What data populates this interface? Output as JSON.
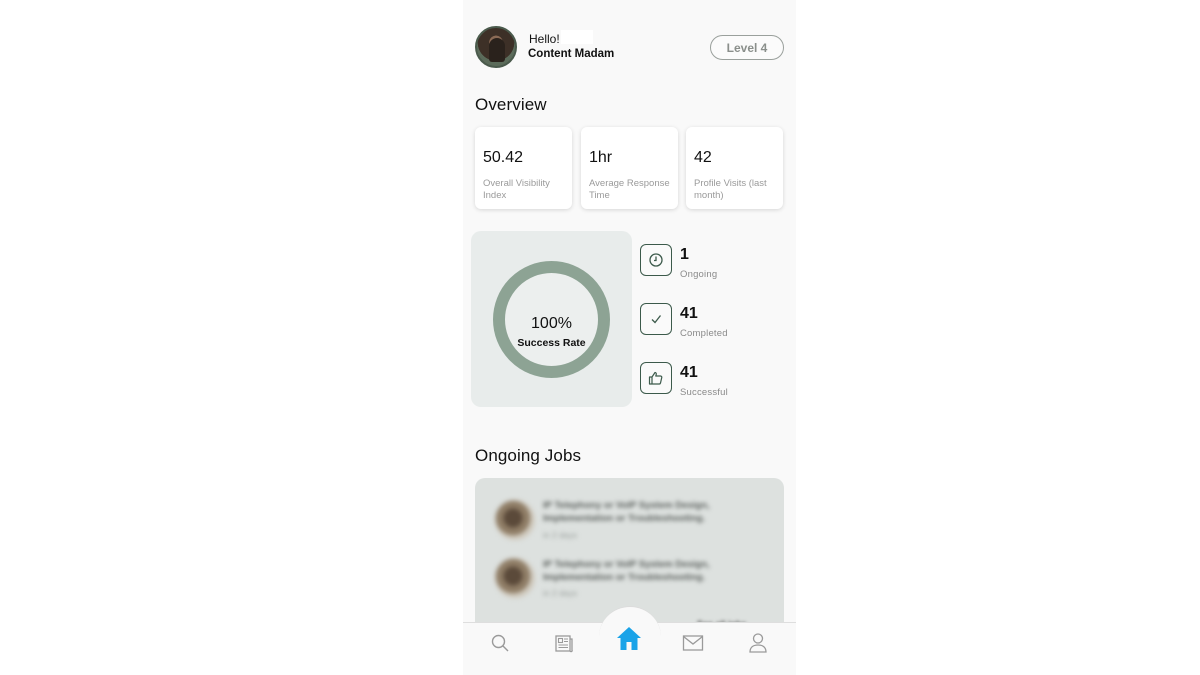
{
  "header": {
    "greeting": "Hello!",
    "user_name": "Content Madam",
    "level_label": "Level 4"
  },
  "overview": {
    "title": "Overview",
    "cards": [
      {
        "value": "50.42",
        "label": "Overall Visibility Index"
      },
      {
        "value": "1hr",
        "label": "Average Response Time"
      },
      {
        "value": "42",
        "label": "Profile Visits (last month)"
      }
    ]
  },
  "success": {
    "percent": "100%",
    "label": "Success Rate",
    "fraction": 1.0
  },
  "stats": [
    {
      "icon": "clock-icon",
      "value": "1",
      "label": "Ongoing"
    },
    {
      "icon": "checkmark-icon",
      "value": "41",
      "label": "Completed"
    },
    {
      "icon": "thumbs-up-icon",
      "value": "41",
      "label": "Successful"
    }
  ],
  "ongoing_jobs": {
    "title": "Ongoing Jobs",
    "items": [
      {
        "title": "IP Telephony or VoIP System Design, Implementation or Troubleshooting.",
        "meta": "in 2 days"
      },
      {
        "title": "IP Telephony or VoIP System Design, Implementation or Troubleshooting.",
        "meta": "in 2 days"
      }
    ],
    "see_all": "See all jobs"
  },
  "nav": {
    "items": [
      "search-icon",
      "news-icon",
      "home-icon",
      "mail-icon",
      "profile-icon"
    ],
    "active": "home-icon",
    "active_color": "#1aa3e8",
    "inactive_color": "#9a9a9a"
  },
  "colors": {
    "ring": "#8da394",
    "icon_border": "#3c5a4b"
  }
}
